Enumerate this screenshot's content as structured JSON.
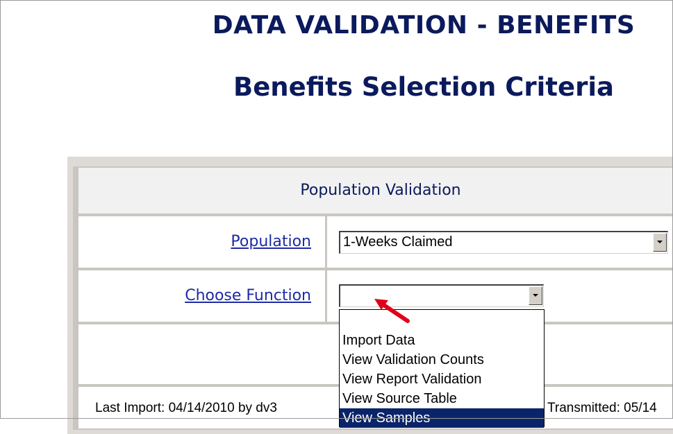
{
  "page": {
    "main_title": "DATA VALIDATION - BENEFITS",
    "subtitle": "Benefits Selection Criteria"
  },
  "form": {
    "section_header": "Population Validation",
    "population_label": "Population",
    "population_value": "1-Weeks Claimed",
    "function_label": "Choose Function",
    "function_value": "",
    "function_options": [
      "Import Data",
      "View Validation Counts",
      "View Report Validation",
      "View Source Table",
      "View Samples"
    ],
    "function_highlighted_option": "View Samples"
  },
  "footer": {
    "last_import": "Last Import: 04/14/2010 by dv3",
    "transmitted": "Transmitted: 05/14"
  },
  "colors": {
    "title": "#0b1a5c",
    "link": "#1d2aa6",
    "highlight": "#0a246a",
    "arrow": "#e0001a",
    "panel": "#dedad6"
  },
  "icons": {
    "dropdown": "chevron-down-icon",
    "pointer": "red-arrow-icon"
  }
}
